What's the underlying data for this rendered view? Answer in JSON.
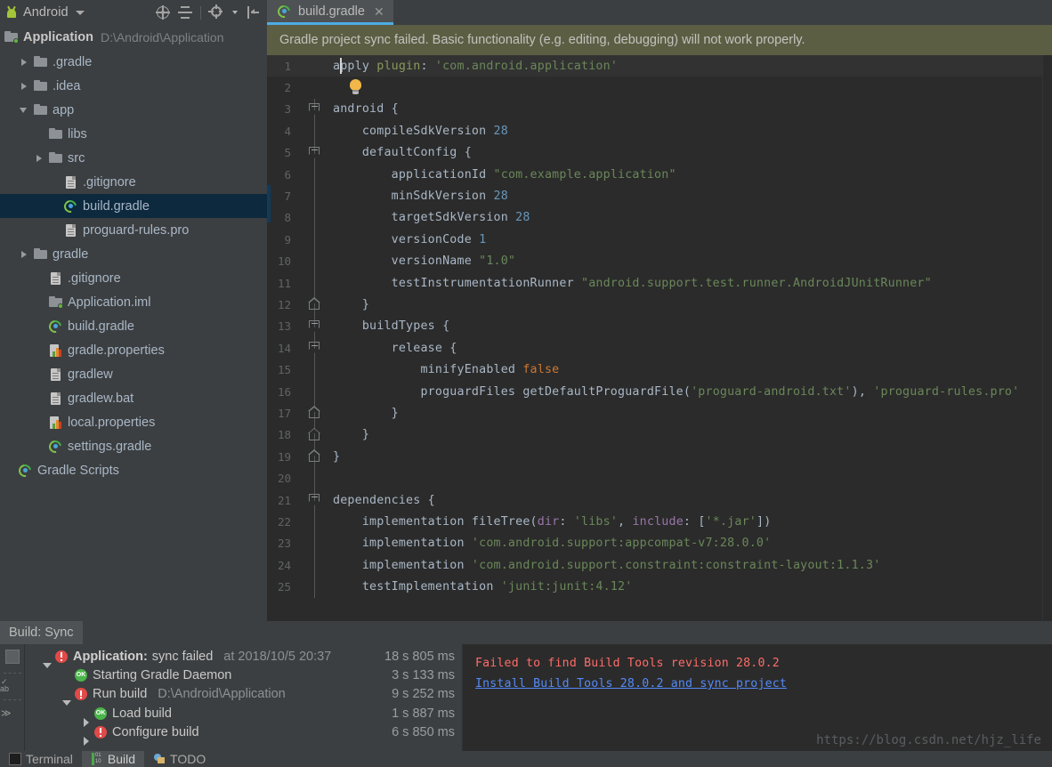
{
  "project_panel": {
    "title": "Android",
    "title_caret_icon": "chevron-down-icon",
    "toolbar": [
      {
        "name": "locate-icon",
        "label": "Select Opened File"
      },
      {
        "name": "collapse-all-icon",
        "label": "Collapse All"
      },
      {
        "name": "gear-icon",
        "label": "Settings"
      },
      {
        "name": "hide-panel-icon",
        "label": "Hide"
      }
    ],
    "root": {
      "label": "Application",
      "path": "D:\\Android\\Application",
      "icon": "module-folder-icon"
    },
    "tree": [
      {
        "label": ".gradle",
        "icon": "folder-icon",
        "arrow": "right",
        "indent": 1,
        "selected": false
      },
      {
        "label": ".idea",
        "icon": "folder-icon",
        "arrow": "right",
        "indent": 1,
        "selected": false
      },
      {
        "label": "app",
        "icon": "folder-icon",
        "arrow": "down",
        "indent": 1,
        "selected": false
      },
      {
        "label": "libs",
        "icon": "folder-icon",
        "arrow": "none",
        "indent": 2,
        "selected": false
      },
      {
        "label": "src",
        "icon": "folder-icon",
        "arrow": "right",
        "indent": 2,
        "selected": false
      },
      {
        "label": ".gitignore",
        "icon": "file-icon",
        "arrow": "none",
        "indent": 3,
        "selected": false
      },
      {
        "label": "build.gradle",
        "icon": "gradle-icon",
        "arrow": "none",
        "indent": 3,
        "selected": true
      },
      {
        "label": "proguard-rules.pro",
        "icon": "file-icon",
        "arrow": "none",
        "indent": 3,
        "selected": false
      },
      {
        "label": "gradle",
        "icon": "folder-icon",
        "arrow": "right",
        "indent": 1,
        "selected": false
      },
      {
        "label": ".gitignore",
        "icon": "file-icon",
        "arrow": "none",
        "indent": 2,
        "selected": false
      },
      {
        "label": "Application.iml",
        "icon": "module-folder-icon",
        "arrow": "none",
        "indent": 2,
        "selected": false
      },
      {
        "label": "build.gradle",
        "icon": "gradle-icon",
        "arrow": "none",
        "indent": 2,
        "selected": false
      },
      {
        "label": "gradle.properties",
        "icon": "properties-icon",
        "arrow": "none",
        "indent": 2,
        "selected": false
      },
      {
        "label": "gradlew",
        "icon": "file-icon",
        "arrow": "none",
        "indent": 2,
        "selected": false
      },
      {
        "label": "gradlew.bat",
        "icon": "file-icon",
        "arrow": "none",
        "indent": 2,
        "selected": false
      },
      {
        "label": "local.properties",
        "icon": "properties-icon",
        "arrow": "none",
        "indent": 2,
        "selected": false
      },
      {
        "label": "settings.gradle",
        "icon": "gradle-icon",
        "arrow": "none",
        "indent": 2,
        "selected": false
      },
      {
        "label": "Gradle Scripts",
        "icon": "gradle-icon",
        "arrow": "none",
        "indent": 0,
        "selected": false
      }
    ]
  },
  "editor": {
    "tab": {
      "label": "build.gradle",
      "icon": "gradle-icon",
      "close_icon": "close-icon"
    },
    "notification": "Gradle project sync failed. Basic functionality (e.g. editing, debugging) will not work properly.",
    "lines": [
      {
        "n": "1",
        "text": "apply plugin: 'com.android.application'"
      },
      {
        "n": "2",
        "text": ""
      },
      {
        "n": "3",
        "text": "android {"
      },
      {
        "n": "4",
        "text": "    compileSdkVersion 28"
      },
      {
        "n": "5",
        "text": "    defaultConfig {"
      },
      {
        "n": "6",
        "text": "        applicationId \"com.example.application\""
      },
      {
        "n": "7",
        "text": "        minSdkVersion 28"
      },
      {
        "n": "8",
        "text": "        targetSdkVersion 28"
      },
      {
        "n": "9",
        "text": "        versionCode 1"
      },
      {
        "n": "10",
        "text": "        versionName \"1.0\""
      },
      {
        "n": "11",
        "text": "        testInstrumentationRunner \"android.support.test.runner.AndroidJUnitRunner\""
      },
      {
        "n": "12",
        "text": "    }"
      },
      {
        "n": "13",
        "text": "    buildTypes {"
      },
      {
        "n": "14",
        "text": "        release {"
      },
      {
        "n": "15",
        "text": "            minifyEnabled false"
      },
      {
        "n": "16",
        "text": "            proguardFiles getDefaultProguardFile('proguard-android.txt'), 'proguard-rules.pro'"
      },
      {
        "n": "17",
        "text": "        }"
      },
      {
        "n": "18",
        "text": "    }"
      },
      {
        "n": "19",
        "text": "}"
      },
      {
        "n": "20",
        "text": ""
      },
      {
        "n": "21",
        "text": "dependencies {"
      },
      {
        "n": "22",
        "text": "    implementation fileTree(dir: 'libs', include: ['*.jar'])"
      },
      {
        "n": "23",
        "text": "    implementation 'com.android.support:appcompat-v7:28.0.0'"
      },
      {
        "n": "24",
        "text": "    implementation 'com.android.support.constraint:constraint-layout:1.1.3'"
      },
      {
        "n": "25",
        "text": "    testImplementation 'junit:junit:4.12'"
      }
    ],
    "intention_bulb_icon": "lightbulb-icon"
  },
  "build_panel": {
    "tab_label": "Build: Sync",
    "side_icons": [
      "stop-icon",
      "filter-icon",
      "toggle-icon",
      "expand-icon"
    ],
    "tree": [
      {
        "arrow": "down",
        "status": "error",
        "bold": "Application:",
        "label": "sync failed",
        "sub": "at 2018/10/5 20:37",
        "time": "18 s 805 ms",
        "indent": 0
      },
      {
        "arrow": "none",
        "status": "ok",
        "bold": "",
        "label": "Starting Gradle Daemon",
        "sub": "",
        "time": "3 s 133 ms",
        "indent": 1
      },
      {
        "arrow": "down",
        "status": "error",
        "bold": "",
        "label": "Run build",
        "sub": "D:\\Android\\Application",
        "time": "9 s 252 ms",
        "indent": 1
      },
      {
        "arrow": "right",
        "status": "ok",
        "bold": "",
        "label": "Load build",
        "sub": "",
        "time": "1 s 887 ms",
        "indent": 2
      },
      {
        "arrow": "right",
        "status": "error",
        "bold": "",
        "label": "Configure build",
        "sub": "",
        "time": "6 s 850 ms",
        "indent": 2
      }
    ],
    "console": {
      "error": "Failed to find Build Tools revision 28.0.2",
      "link": "Install Build Tools 28.0.2 and sync project"
    },
    "watermark": "https://blog.csdn.net/hjz_life"
  },
  "bottom_tabs": [
    {
      "label": "Terminal",
      "icon": "terminal-icon",
      "active": false
    },
    {
      "label": "Build",
      "icon": "build-icon",
      "active": true
    },
    {
      "label": "TODO",
      "icon": "todo-icon",
      "active": false
    }
  ],
  "colors": {
    "panel_bg": "#3c3f41",
    "editor_bg": "#2b2b2b",
    "selection": "#0d293e",
    "tab_underline": "#4eade5",
    "notification_bg": "#5c5e44",
    "error_red": "#ff6b68",
    "link_blue": "#548af7",
    "string_green": "#6a8759",
    "keyword_orange": "#cc7832",
    "number_blue": "#6897bb"
  }
}
